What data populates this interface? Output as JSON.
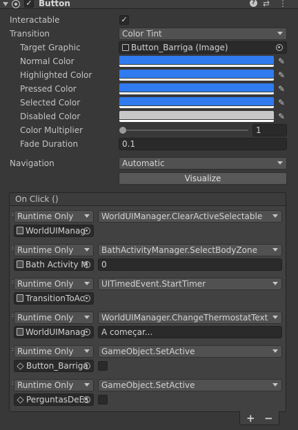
{
  "header": {
    "title": "Button",
    "enabled": true,
    "icons": [
      "foldout-arrow-icon",
      "component-icon",
      "help-icon",
      "preset-icon",
      "kebab-menu-icon"
    ]
  },
  "props": {
    "interactable": {
      "label": "Interactable",
      "checked": true
    },
    "transition": {
      "label": "Transition",
      "value": "Color Tint"
    },
    "target_graphic": {
      "label": "Target Graphic",
      "value": "Button_Barriga (Image)"
    },
    "normal_color": {
      "label": "Normal Color",
      "color": "#2f7bef"
    },
    "highlighted_color": {
      "label": "Highlighted Color",
      "color": "#2f7bef"
    },
    "pressed_color": {
      "label": "Pressed Color",
      "color": "#2f7bef"
    },
    "selected_color": {
      "label": "Selected Color",
      "color": "#2f7bef"
    },
    "disabled_color": {
      "label": "Disabled Color",
      "color": "#c8c8c8"
    },
    "color_multiplier": {
      "label": "Color Multiplier",
      "value": "1",
      "fraction": 0.0
    },
    "fade_duration": {
      "label": "Fade Duration",
      "value": "0.1"
    },
    "navigation": {
      "label": "Navigation",
      "value": "Automatic"
    },
    "visualize_label": "Visualize"
  },
  "onclick": {
    "title": "On Click ()",
    "events": [
      {
        "mode": "Runtime Only",
        "function": "WorldUIManager.ClearActiveSelectable",
        "target": "WorldUIManag",
        "target_icon": "script-icon",
        "arg_type": "none",
        "arg": ""
      },
      {
        "mode": "Runtime Only",
        "function": "BathActivityManager.SelectBodyZone",
        "target": "Bath Activity M",
        "target_icon": "script-icon",
        "arg_type": "text",
        "arg": "0"
      },
      {
        "mode": "Runtime Only",
        "function": "UITimedEvent.StartTimer",
        "target": "TransitionToAc",
        "target_icon": "script-icon",
        "arg_type": "none",
        "arg": ""
      },
      {
        "mode": "Runtime Only",
        "function": "WorldUIManager.ChangeThermostatText",
        "target": "WorldUIManag",
        "target_icon": "script-icon",
        "arg_type": "text",
        "arg": "A começar..."
      },
      {
        "mode": "Runtime Only",
        "function": "GameObject.SetActive",
        "target": "Button_Barriga",
        "target_icon": "gameobject-icon",
        "arg_type": "bool",
        "arg": ""
      },
      {
        "mode": "Runtime Only",
        "function": "GameObject.SetActive",
        "target": "PerguntasDeEs",
        "target_icon": "gameobject-icon",
        "arg_type": "bool",
        "arg": ""
      }
    ],
    "add_label": "+",
    "remove_label": "−"
  },
  "colors": {
    "background": "#383838",
    "accent_blue": "#2f7bef",
    "disabled_gray": "#c8c8c8"
  }
}
